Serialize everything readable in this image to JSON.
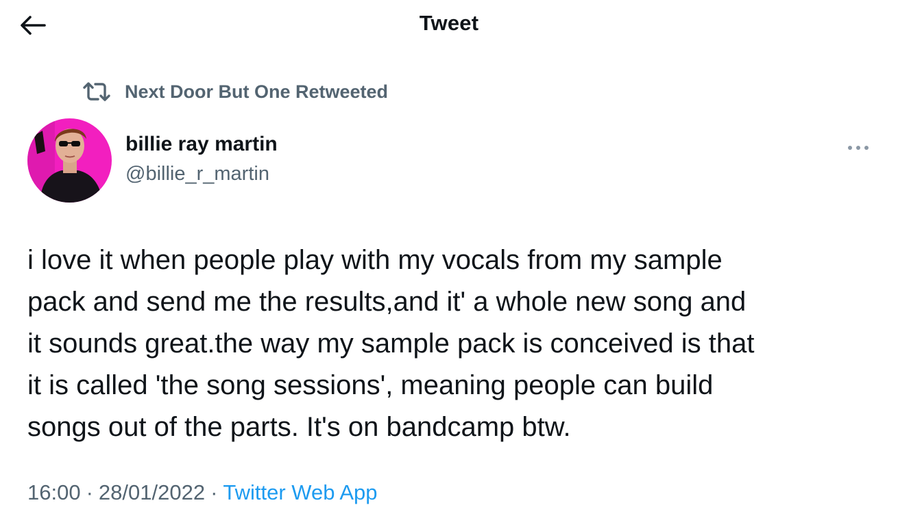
{
  "header": {
    "title": "Tweet",
    "back_icon": "arrow-left-icon"
  },
  "retweet_context": {
    "icon": "retweet-icon",
    "text": "Next Door But One Retweeted"
  },
  "author": {
    "name": "billie ray martin",
    "handle": "@billie_r_martin",
    "avatar": "avatar-photo"
  },
  "more_icon": "more-horizontal-icon",
  "tweet": {
    "text": "i love it when people play with my vocals from my sample\npack and send me the results,and it' a whole new song and\nit sounds great.the way my sample pack is conceived is that\nit is called 'the song sessions', meaning people can build\nsongs out of the parts. It's on bandcamp btw."
  },
  "meta": {
    "time": "16:00",
    "separator": "·",
    "date": "28/01/2022",
    "source": "Twitter Web App"
  },
  "colors": {
    "text_primary": "#0f1419",
    "text_secondary": "#536471",
    "link": "#1d9bf0",
    "avatar_background": "#f21fbf"
  }
}
